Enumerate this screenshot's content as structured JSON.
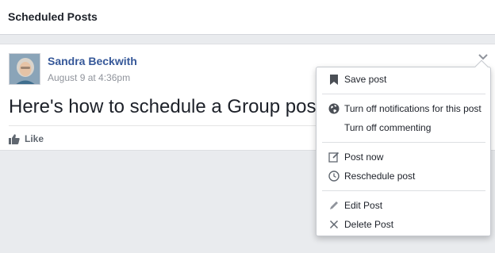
{
  "header": {
    "title": "Scheduled Posts"
  },
  "post": {
    "author": "Sandra Beckwith",
    "timestamp": "August 9 at 4:36pm",
    "text": "Here's how to schedule a Group post",
    "like_label": "Like"
  },
  "menu": {
    "items": [
      {
        "label": "Save post",
        "icon": "bookmark-icon"
      },
      {
        "label": "Turn off notifications for this post",
        "icon": "globe-icon"
      },
      {
        "label": "Turn off commenting",
        "icon": ""
      },
      {
        "label": "Post now",
        "icon": "compose-icon"
      },
      {
        "label": "Reschedule post",
        "icon": "clock-icon"
      },
      {
        "label": "Edit Post",
        "icon": "pencil-icon"
      },
      {
        "label": "Delete Post",
        "icon": "close-icon"
      }
    ]
  },
  "colors": {
    "author_link": "#365899",
    "page_background": "#e9ebee",
    "icon_gray": "#606770"
  }
}
